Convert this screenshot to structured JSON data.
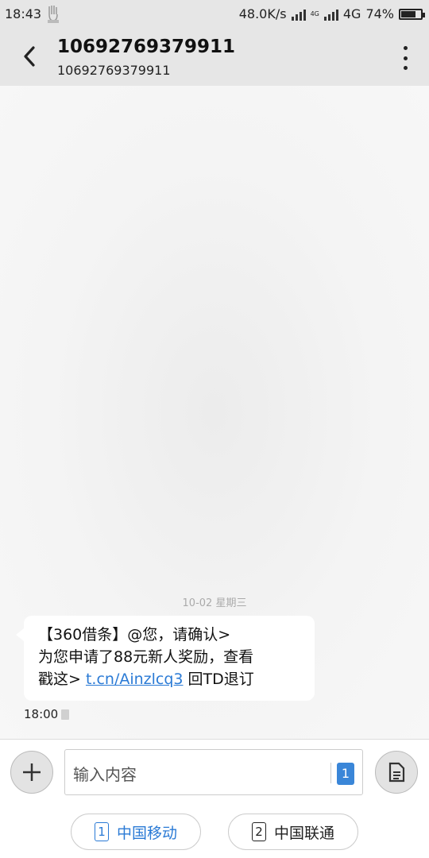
{
  "status_bar": {
    "time": "18:43",
    "net_speed": "48.0K/s",
    "sim2_network_tag": "4G",
    "network": "4G",
    "battery_percent": "74%",
    "battery_level": 0.74
  },
  "header": {
    "title": "10692769379911",
    "subtitle": "10692769379911"
  },
  "thread": {
    "date_separator": "10-02  星期三",
    "message": {
      "line1": "【360借条】@您，请确认>",
      "line2": "为您申请了88元新人奖励，查看",
      "line3_prefix": "戳这> ",
      "link": "t.cn/Ainzlcq3",
      "line3_suffix": " 回TD退订",
      "time": "18:00"
    }
  },
  "composer": {
    "placeholder": "输入内容",
    "selected_sim": "1",
    "sim1_number": "1",
    "sim1_label": "中国移动",
    "sim2_number": "2",
    "sim2_label": "中国联通"
  },
  "colors": {
    "accent": "#2a7ad5",
    "header_bg": "#e6e6e6"
  }
}
